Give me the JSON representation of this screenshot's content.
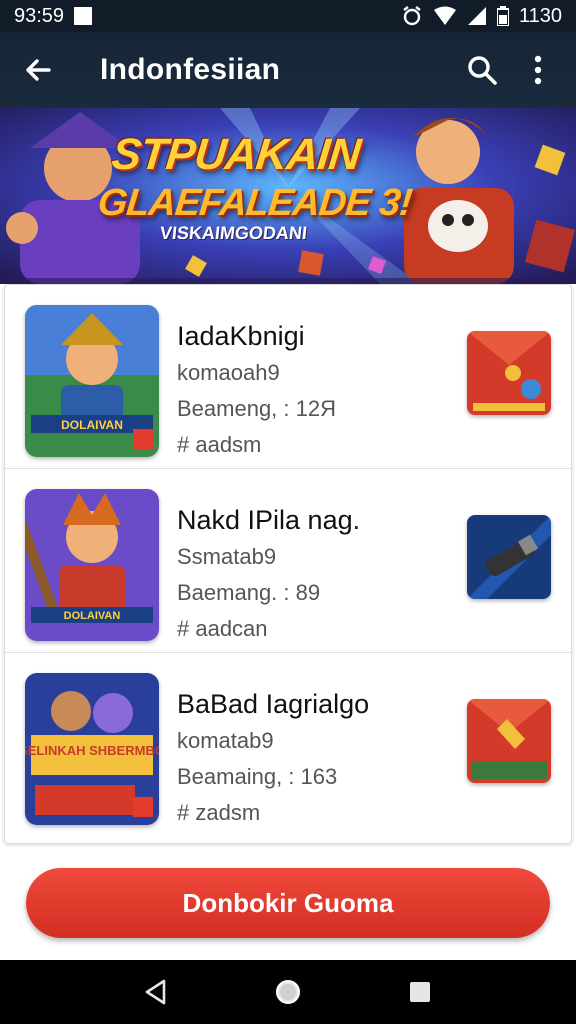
{
  "status_bar": {
    "time_left": "93:59",
    "time_right": "1130"
  },
  "top_bar": {
    "title": "Indonfesiian",
    "back_icon": "arrow-left-icon",
    "search_icon": "search-icon",
    "menu_icon": "more-vert-icon"
  },
  "hero": {
    "title": "STPUAKAIN",
    "subtitle": "GLAEFALEADE 3!",
    "tagline": "VISKAIMGODANI"
  },
  "list": [
    {
      "title": "IadaKbnigi",
      "meta1": "komaoah9",
      "meta2": "Beameng, : 12Я",
      "meta3": "# aadsm",
      "thumb_label": "DOLAIVAN",
      "action_icon": "red-box-icon"
    },
    {
      "title": "Nakd IPila nag.",
      "meta1": "Ssmatab9",
      "meta2": "Baemang. : 89",
      "meta3": "# aadcan",
      "thumb_label": "DOLAIVAN",
      "action_icon": "blue-tool-icon"
    },
    {
      "title": "BaBad Iagrialgo",
      "meta1": "komatab9",
      "meta2": "Beamaing, : 163",
      "meta3": "# zadsm",
      "thumb_label": "SELINKAH SHBERMBO",
      "action_icon": "red-box-icon"
    }
  ],
  "cta": {
    "label": "Donbokir Guoma"
  },
  "nav": {
    "back_icon": "nav-back-icon",
    "home_icon": "nav-home-icon",
    "recents_icon": "nav-recents-icon"
  },
  "colors": {
    "status_bg": "#111c28",
    "topbar_bg": "#162536",
    "cta_red": "#e03a2e"
  }
}
